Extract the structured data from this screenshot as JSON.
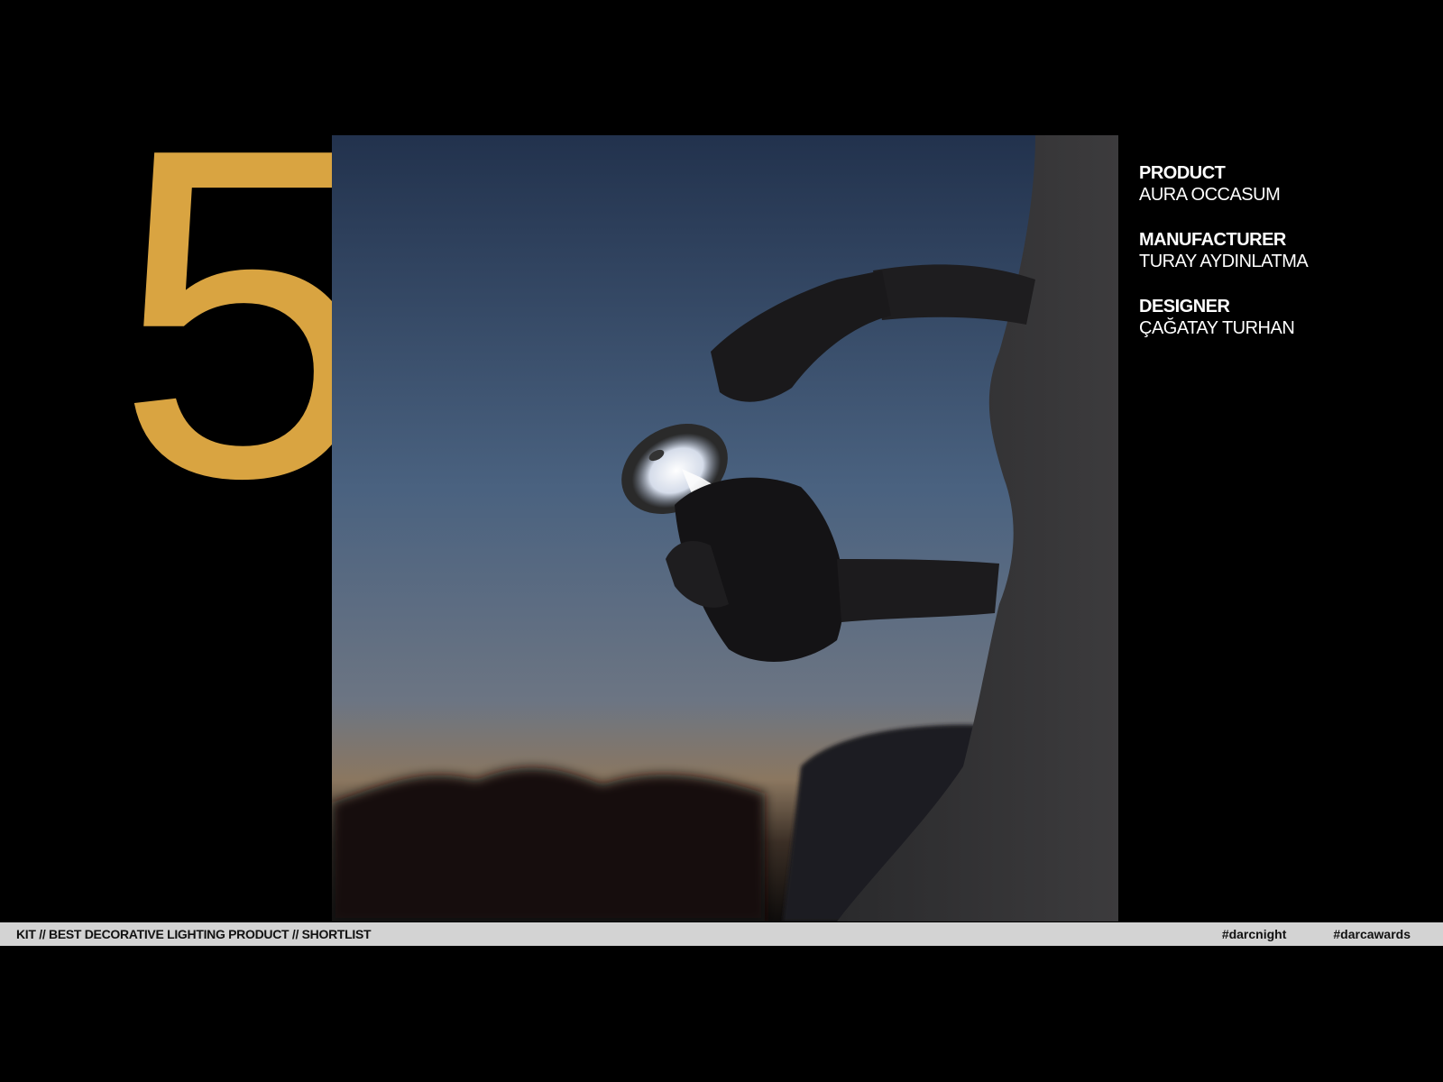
{
  "slide": {
    "number": "5",
    "number_color": "#D9A441",
    "background": "#000000"
  },
  "info": {
    "product_label": "PRODUCT",
    "product_value": "AURA OCCASUM",
    "manufacturer_label": "MANUFACTURER",
    "manufacturer_value": "TURAY AYDINLATMA",
    "designer_label": "DESIGNER",
    "designer_value": "ÇAĞATAY TURHAN"
  },
  "footer": {
    "title": "KIT // BEST DECORATIVE LIGHTING PRODUCT // SHORTLIST",
    "tags": [
      "#darcnight",
      "#darcawards"
    ],
    "bar_color": "#D3D3D3"
  }
}
